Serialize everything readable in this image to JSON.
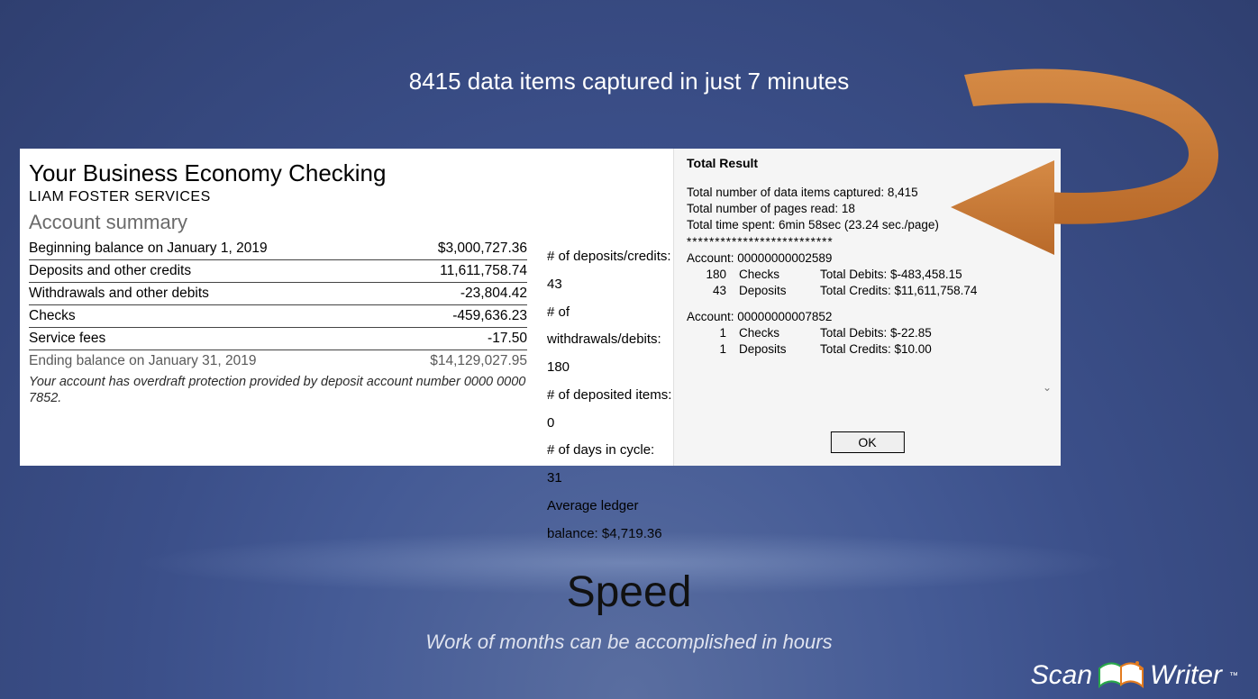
{
  "headline": "8415 data items captured in just 7 minutes",
  "statement": {
    "title": "Your Business Economy Checking",
    "owner": "LIAM FOSTER SERVICES",
    "section": "Account summary",
    "rows": [
      {
        "label": "Beginning balance on January 1, 2019",
        "value": "$3,000,727.36"
      },
      {
        "label": "Deposits and other credits",
        "value": "11,611,758.74"
      },
      {
        "label": "Withdrawals and other debits",
        "value": "-23,804.42"
      },
      {
        "label": "Checks",
        "value": "-459,636.23"
      },
      {
        "label": "Service fees",
        "value": "-17.50"
      },
      {
        "label": "Ending balance on January 31, 2019",
        "value": "$14,129,027.95"
      }
    ],
    "overdraft": "Your account has overdraft protection provided by  deposit  account  number 0000 0000 7852."
  },
  "metrics": {
    "deposits": "# of deposits/credits: 43",
    "withdrawals": "# of withdrawals/debits: 180",
    "deposited": "# of deposited items: 0",
    "days": "# of days in cycle: 31",
    "avg": "Average ledger balance: $4,719.36"
  },
  "dialog": {
    "title": "Total Result",
    "line1": "Total number of data items captured: 8,415",
    "line2": "Total number of pages read: 18",
    "line3": "Total time spent: 6min 58sec (23.24 sec./page)",
    "sep": "**************************",
    "acct1": {
      "header": "Account: 00000000002589",
      "checks_n": "180",
      "checks_l": "Checks",
      "debits": "Total Debits: $-483,458.15",
      "dep_n": "43",
      "dep_l": "Deposits",
      "credits": "Total Credits: $11,611,758.74"
    },
    "acct2": {
      "header": "Account: 00000000007852",
      "checks_n": "1",
      "checks_l": "Checks",
      "debits": "Total Debits: $-22.85",
      "dep_n": "1",
      "dep_l": "Deposits",
      "credits": "Total Credits: $10.00"
    },
    "ok": "OK"
  },
  "footer": {
    "title": "Speed",
    "subtitle": "Work of months can be accomplished in hours"
  },
  "logo": {
    "left": "Scan",
    "right": "Writer"
  },
  "colors": {
    "arrow": "#c97a34"
  }
}
